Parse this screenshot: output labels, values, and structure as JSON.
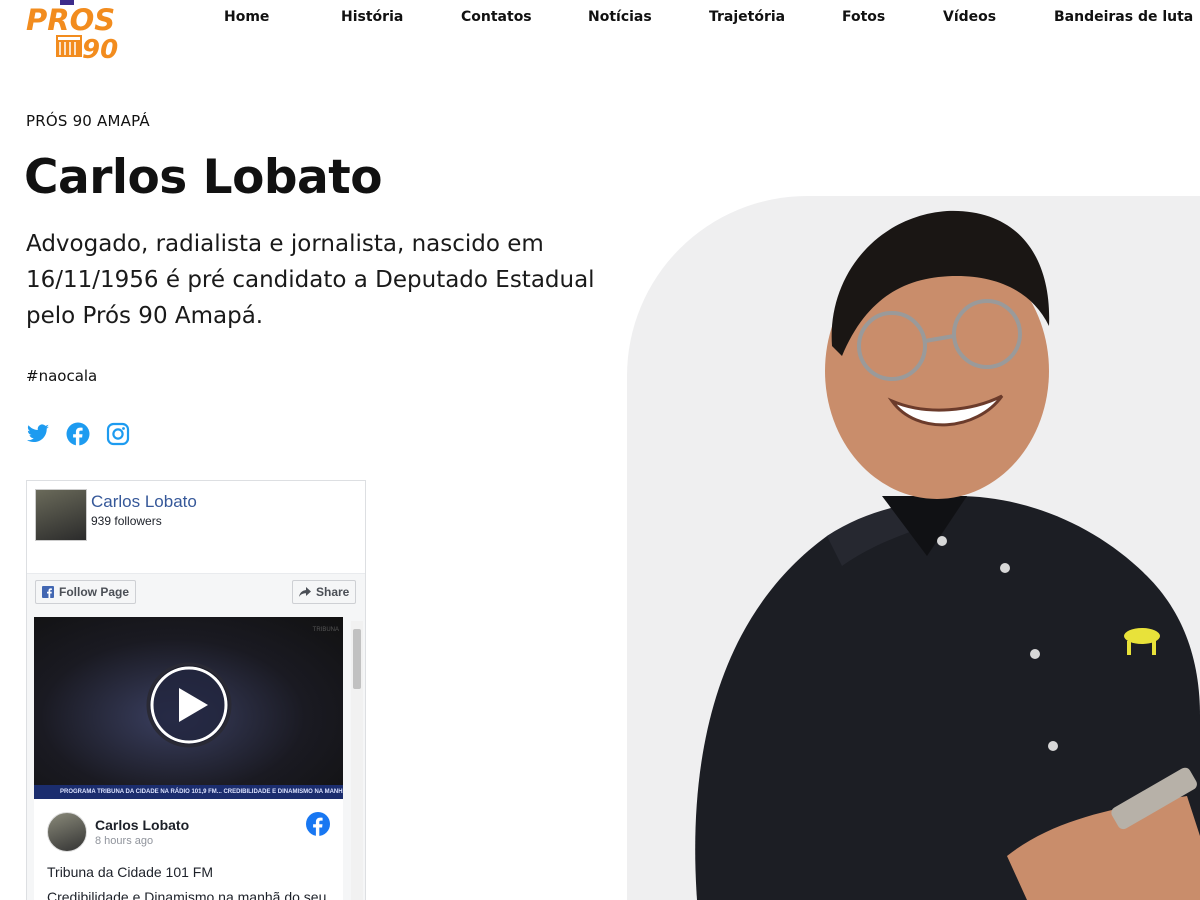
{
  "brand": {
    "logo_text_top": "PROS",
    "logo_text_bottom": "90",
    "logo_color": "#f28c1e",
    "logo_accent": "#3d2b8a"
  },
  "nav": {
    "items": [
      {
        "label": "Home"
      },
      {
        "label": "História"
      },
      {
        "label": "Contatos"
      },
      {
        "label": "Notícias"
      },
      {
        "label": "Trajetória"
      },
      {
        "label": "Fotos"
      },
      {
        "label": "Vídeos"
      },
      {
        "label": "Bandeiras de luta"
      }
    ]
  },
  "hero": {
    "kicker": "PRÓS 90 AMAPÁ",
    "title": "Carlos Lobato",
    "lead": "Advogado, radialista e jornalista, nascido em 16/11/1956 é pré candidato a Deputado Estadual pelo Prós 90 Amapá.",
    "hashtag": "#naocala"
  },
  "socials": [
    {
      "icon": "twitter-icon",
      "color": "#1d9bf0"
    },
    {
      "icon": "facebook-icon",
      "color": "#1d9bf0"
    },
    {
      "icon": "instagram-icon",
      "color": "#1d9bf0"
    }
  ],
  "facebook_widget": {
    "page_name": "Carlos Lobato",
    "followers": "939 followers",
    "follow_label": "Follow Page",
    "share_label": "Share",
    "video_caption": "PROGRAMA TRIBUNA DA CIDADE NA RÁDIO 101,9 FM...     CREDIBILIDADE E DINAMISMO NA MANHÃ",
    "video_brand": "TRIBUNA",
    "post": {
      "author": "Carlos Lobato",
      "time": "8 hours ago",
      "text_line1": "Tribuna da Cidade 101 FM",
      "text_line2": "Credibilidade e Dinamismo na manhã do seu"
    }
  }
}
